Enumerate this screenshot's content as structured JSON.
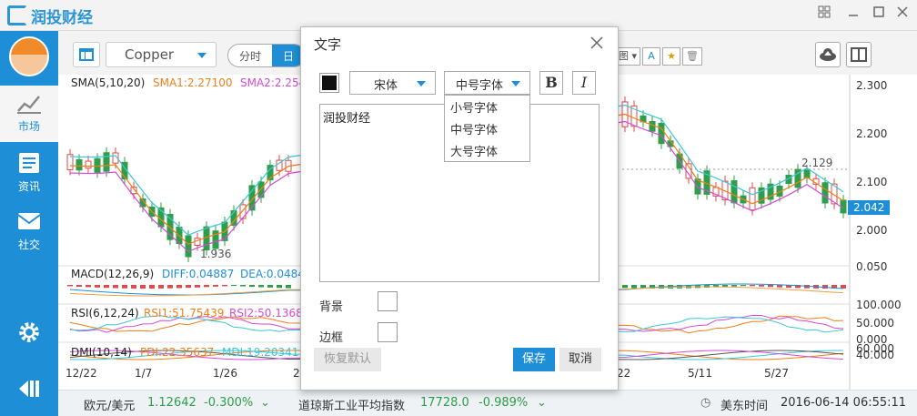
{
  "app": {
    "name": "润投财经"
  },
  "sidebar": {
    "items": [
      {
        "label": "市场",
        "icon": "chart-icon"
      },
      {
        "label": "资讯",
        "icon": "news-icon"
      },
      {
        "label": "社交",
        "icon": "mail-icon"
      }
    ],
    "settings_icon": "gear-icon",
    "exit_icon": "exit-icon"
  },
  "toolbar": {
    "symbol": "Copper",
    "periods": [
      "分时",
      "日"
    ],
    "selected_period": "日"
  },
  "chart": {
    "sma_label": "SMA(5,10,20)",
    "sma1": "SMA1:2.27100",
    "sma2": "SMA2:2.254",
    "macd_label": "MACD(12,26,9)",
    "diff": "DIFF:0.04887",
    "dea": "DEA:0.0484",
    "rsi_label": "RSI(6,12,24)",
    "rsi1": "RSI1:51.75439",
    "rsi2": "RSI2:50.13682",
    "dmi_label": "DMI(10,14)",
    "pdi": "PDI:22.35637",
    "mdi": "MDI:19.20341",
    "price_axis": [
      "2.300",
      "2.200",
      "2.100",
      "2.000"
    ],
    "macd_axis": "0.050",
    "rsi_axis": [
      "100.000",
      "50.000",
      "0.000"
    ],
    "dmi_axis": [
      "60.000",
      "40.000"
    ],
    "current_price": "2.042",
    "high_mark": "2.129",
    "low_mark": "1.936",
    "dates": [
      "12/22",
      "1/7",
      "1/26",
      "2",
      "22",
      "5/11",
      "5/27"
    ],
    "colors": {
      "up": "#e04a4a",
      "down": "#2e9e4a",
      "sma1": "#ee7f1a",
      "sma2": "#d64bd4",
      "sma3": "#3cc7d8",
      "diff": "#1e8fd6",
      "dea": "#1e8fd6"
    }
  },
  "status": {
    "pair1_name": "欧元/美元",
    "pair1_price": "1.12642",
    "pair1_change": "-0.300%",
    "pair2_name": "道琼斯工业平均指数",
    "pair2_price": "17728.0",
    "pair2_change": "-0.989%",
    "time_label": "美东时间",
    "time_value": "2016-06-14 06:55:11"
  },
  "dialog": {
    "title": "文字",
    "font": "宋体",
    "size": "中号字体",
    "size_options": [
      "小号字体",
      "中号字体",
      "大号字体"
    ],
    "bold": "B",
    "italic": "I",
    "text": "润投财经",
    "bg_label": "背景",
    "border_label": "边框",
    "reset": "恢复默认",
    "save": "保存",
    "cancel": "取消",
    "text_color": "#111111"
  }
}
